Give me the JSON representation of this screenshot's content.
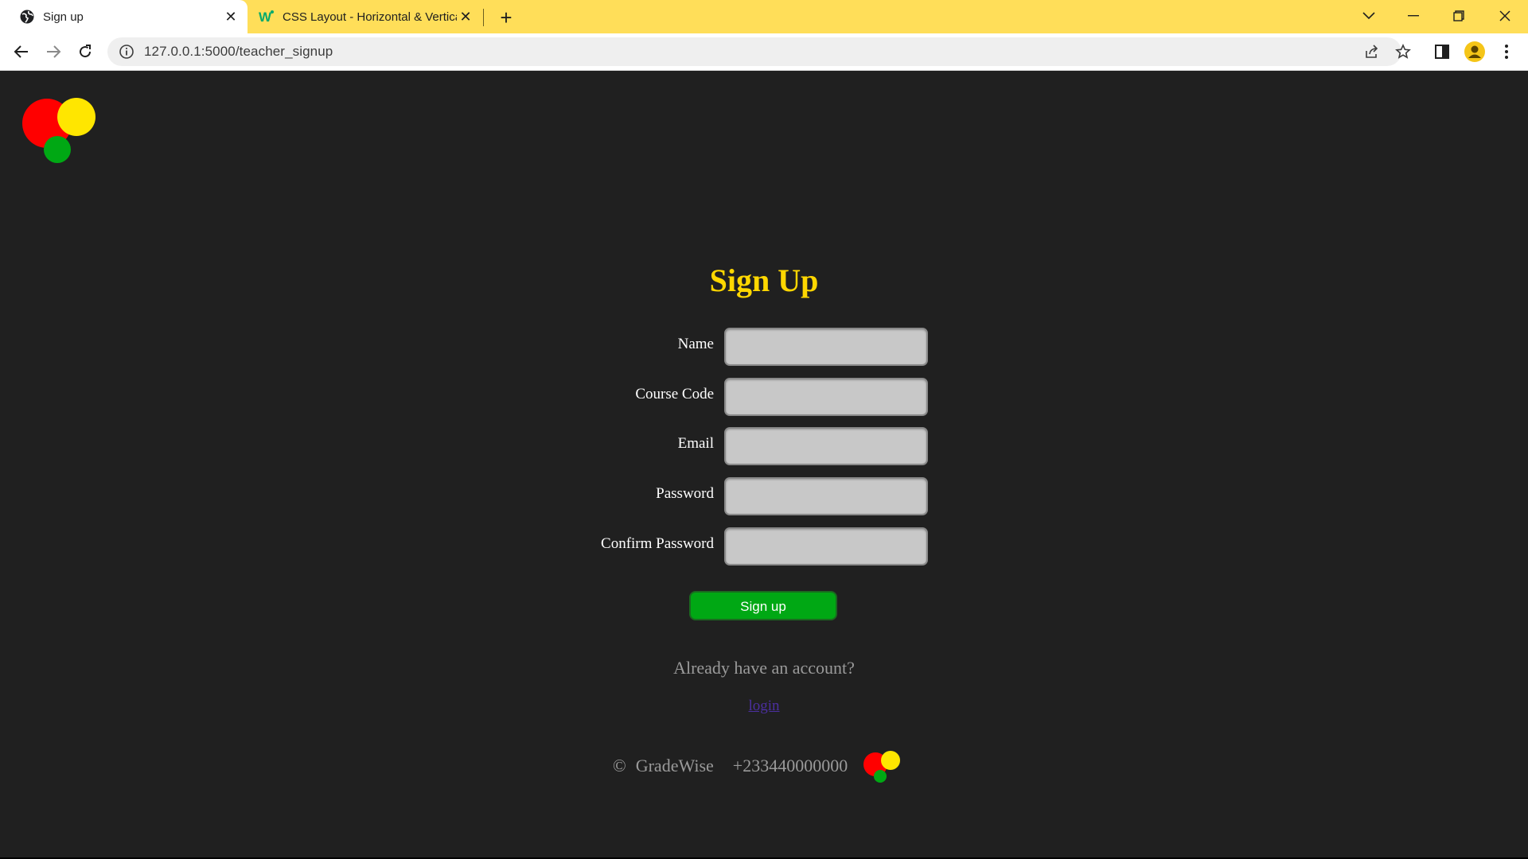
{
  "browser": {
    "tabs": [
      {
        "title": "Sign up",
        "favicon": "globe-icon",
        "active": true
      },
      {
        "title": "CSS Layout - Horizontal & Vertical",
        "favicon": "w3schools-icon",
        "active": false
      }
    ],
    "url": "127.0.0.1:5000/teacher_signup",
    "tabbar_color": "#FFDE59"
  },
  "logo": {
    "colors": {
      "red": "#FF0000",
      "yellow": "#FFE600",
      "green": "#00A814"
    }
  },
  "form": {
    "heading": "Sign Up",
    "fields": [
      {
        "label": "Name",
        "value": ""
      },
      {
        "label": "Course Code",
        "value": ""
      },
      {
        "label": "Email",
        "value": ""
      },
      {
        "label": "Password",
        "value": ""
      },
      {
        "label": "Confirm Password",
        "value": ""
      }
    ],
    "submit_label": "Sign up",
    "submit_color": "#00A814"
  },
  "account": {
    "prompt": "Already have an account?",
    "login_link": "login"
  },
  "footer": {
    "copyright_symbol": "©",
    "brand": "GradeWise",
    "phone": "+233440000000"
  },
  "colors": {
    "page_background": "#202020",
    "heading": "#FFD700",
    "input_background": "#C8C8C8"
  }
}
